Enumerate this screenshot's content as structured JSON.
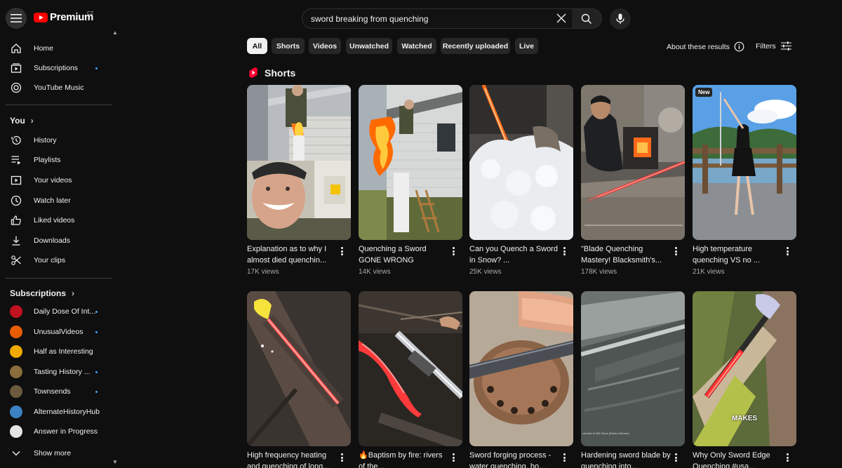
{
  "header": {
    "logo_text": "Premium",
    "country_code": "CZ",
    "search_query": "sword breaking from quenching"
  },
  "sidebar": {
    "main": [
      {
        "label": "Home",
        "icon": "home-icon"
      },
      {
        "label": "Subscriptions",
        "icon": "subscriptions-icon",
        "dot": true
      },
      {
        "label": "YouTube Music",
        "icon": "music-icon"
      }
    ],
    "you_header": "You",
    "you_items": [
      {
        "label": "History",
        "icon": "history-icon"
      },
      {
        "label": "Playlists",
        "icon": "playlists-icon"
      },
      {
        "label": "Your videos",
        "icon": "your-videos-icon"
      },
      {
        "label": "Watch later",
        "icon": "watch-later-icon"
      },
      {
        "label": "Liked videos",
        "icon": "thumbs-up-icon"
      },
      {
        "label": "Downloads",
        "icon": "download-icon"
      },
      {
        "label": "Your clips",
        "icon": "scissors-icon"
      }
    ],
    "subs_header": "Subscriptions",
    "subs": [
      {
        "label": "Daily Dose Of Int...",
        "dot": true,
        "color": "#c1121f"
      },
      {
        "label": "UnusualVideos",
        "dot": true,
        "color": "#e85d04"
      },
      {
        "label": "Half as Interesting",
        "dot": false,
        "color": "#f2a900"
      },
      {
        "label": "Tasting History ...",
        "dot": true,
        "color": "#8a6d3b"
      },
      {
        "label": "Townsends",
        "dot": true,
        "color": "#6b5b3e"
      },
      {
        "label": "AlternateHistoryHub",
        "dot": false,
        "color": "#3b82c4"
      },
      {
        "label": "Answer in Progress",
        "dot": false,
        "color": "#e5e5e5"
      }
    ],
    "show_more": "Show more"
  },
  "chips": [
    "All",
    "Shorts",
    "Videos",
    "Unwatched",
    "Watched",
    "Recently uploaded",
    "Live"
  ],
  "about_results": "About these results",
  "filters_label": "Filters",
  "shorts_section": {
    "title": "Shorts",
    "row1": [
      {
        "title": "Explanation as to why I almost died quenchin...",
        "views": "17K views"
      },
      {
        "title": "Quenching a Sword GONE WRONG",
        "views": "14K views"
      },
      {
        "title": "Can you Quench a Sword in Snow? ...",
        "views": "25K views"
      },
      {
        "title": "\"Blade Quenching Mastery! Blacksmith's...",
        "views": "178K views"
      },
      {
        "title": "High temperature quenching VS no ...",
        "views": "21K views",
        "badge": "New"
      }
    ],
    "row2": [
      {
        "title": "High frequency heating and quenching of long..."
      },
      {
        "title": "🔥Baptism by fire: rivers of the..."
      },
      {
        "title": "Sword forging process - water quenching, ho..."
      },
      {
        "title": "Hardening sword blade by quenching into..."
      },
      {
        "title": "Why Only Sword Edge Quenching #usa..."
      }
    ],
    "thumb_caption_makes": "MAKES",
    "thumb_watermark": "comelin & Will Stone (Roblox Winner)"
  },
  "colors": {
    "background": "#0f0f0f",
    "chip": "#272727",
    "active_chip": "#f1f1f1",
    "brand_red": "#ff0000",
    "new_dot": "#3ea6ff"
  }
}
